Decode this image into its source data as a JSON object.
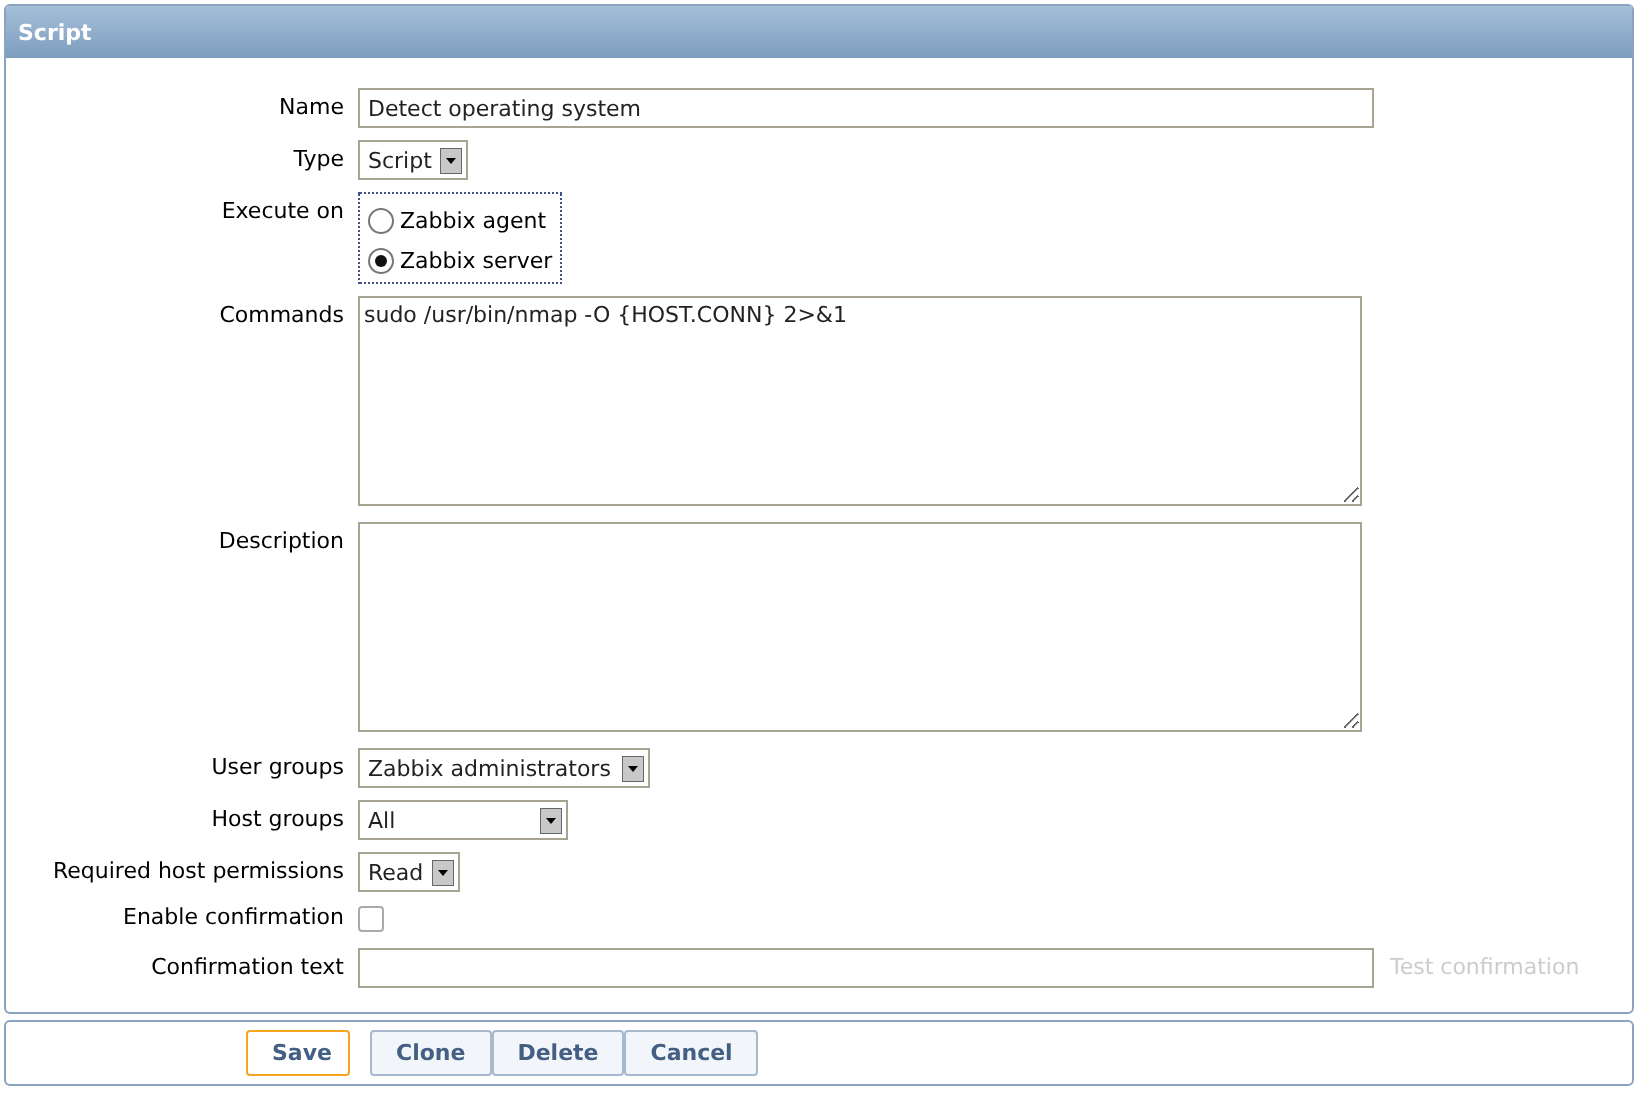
{
  "panel": {
    "title": "Script"
  },
  "fields": [
    {
      "kind": "text",
      "label": "Name",
      "value": "Detect operating system"
    },
    {
      "kind": "select",
      "label": "Type",
      "value": "Script"
    },
    {
      "kind": "radio",
      "label": "Execute on",
      "options": [
        {
          "label": "Zabbix agent",
          "selected": false
        },
        {
          "label": "Zabbix server",
          "selected": true
        }
      ]
    },
    {
      "kind": "textarea",
      "label": "Commands",
      "value": "sudo /usr/bin/nmap -O {HOST.CONN} 2>&1"
    },
    {
      "kind": "textarea",
      "label": "Description"
    },
    {
      "kind": "select",
      "label": "User groups",
      "value": "Zabbix administrators"
    },
    {
      "kind": "select",
      "label": "Host groups",
      "value": "All"
    },
    {
      "kind": "select",
      "label": "Required host permissions",
      "value": "Read"
    },
    {
      "kind": "checkbox",
      "label": "Enable confirmation",
      "checked": false
    },
    {
      "kind": "confirm",
      "label": "Confirmation text",
      "link": {
        "label": "Test confirmation",
        "disabled": true
      }
    }
  ],
  "buttons": [
    {
      "label": "Save",
      "primary": true
    },
    {
      "label": "Clone",
      "primary": false
    },
    {
      "label": "Delete",
      "primary": false
    },
    {
      "label": "Cancel",
      "primary": false
    }
  ]
}
